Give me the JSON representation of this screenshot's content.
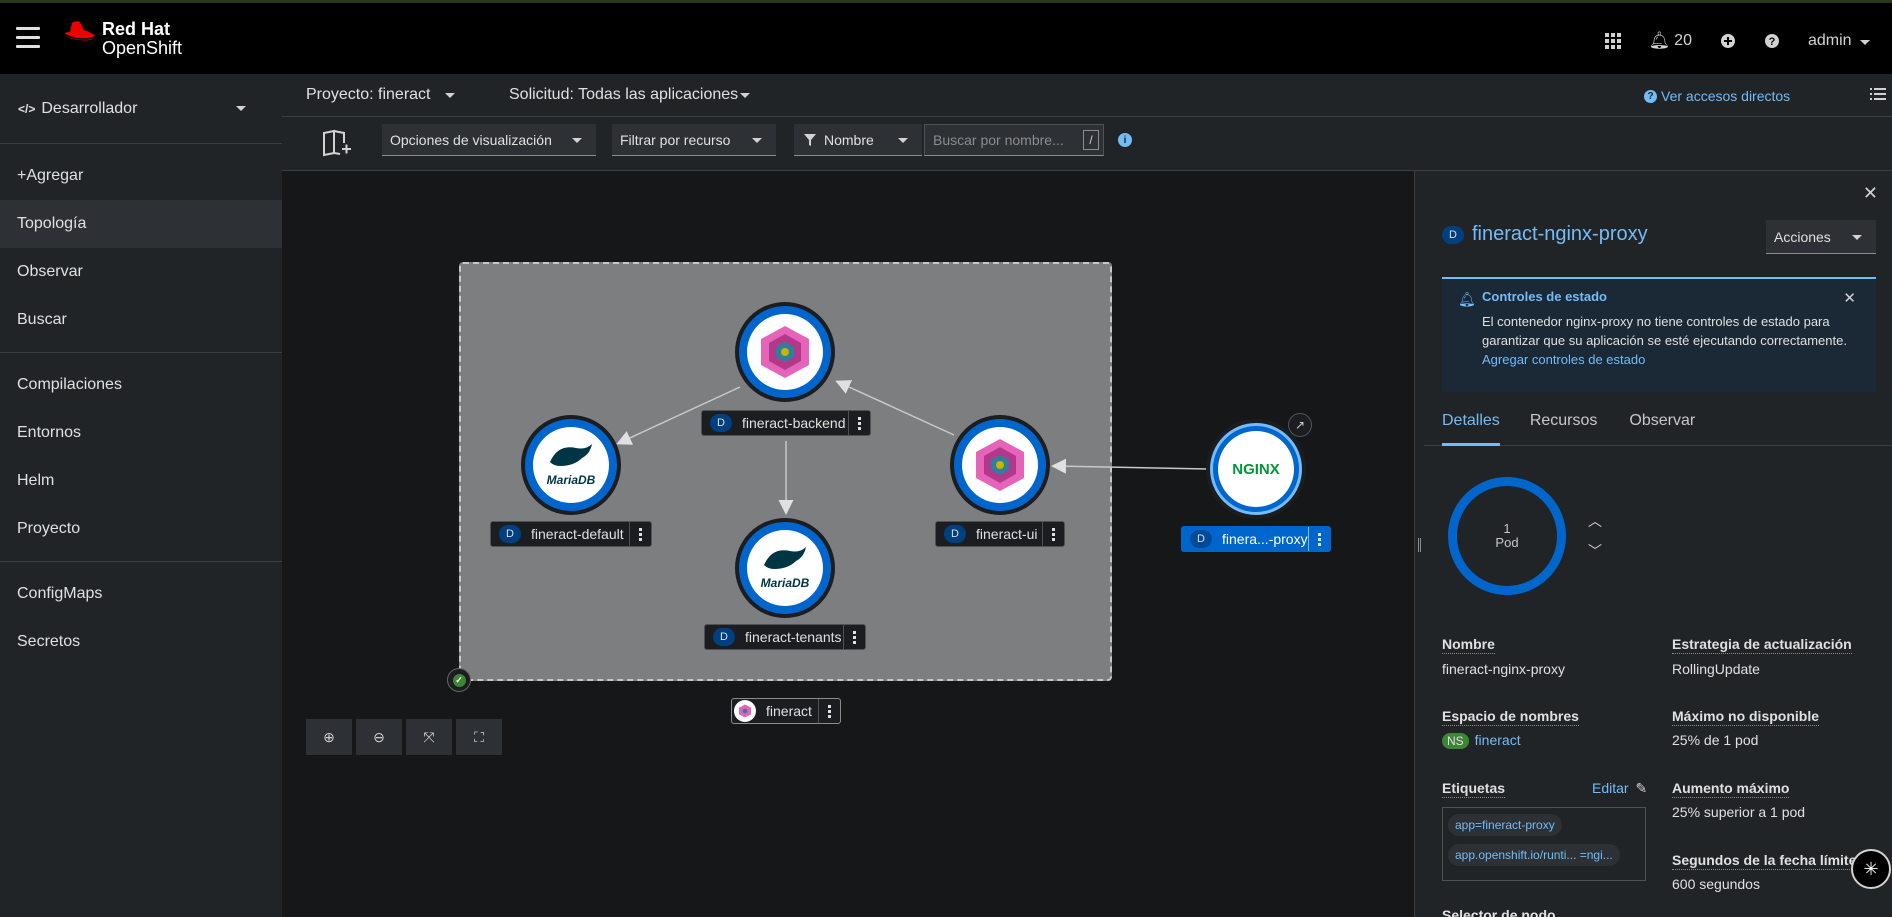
{
  "masthead": {
    "brand_line1": "Red Hat",
    "brand_line2": "OpenShift",
    "notifications_count": "20",
    "user": "admin"
  },
  "sidebar": {
    "perspective": "Desarrollador",
    "groups": [
      [
        "+Agregar",
        "Topología",
        "Observar",
        "Buscar"
      ],
      [
        "Compilaciones",
        "Entornos",
        "Helm",
        "Proyecto"
      ],
      [
        "ConfigMaps",
        "Secretos"
      ]
    ],
    "items": {
      "agregar": "+Agregar",
      "topologia": "Topología",
      "observar": "Observar",
      "buscar": "Buscar",
      "compilaciones": "Compilaciones",
      "entornos": "Entornos",
      "helm": "Helm",
      "proyecto": "Proyecto",
      "configmaps": "ConfigMaps",
      "secretos": "Secretos"
    }
  },
  "projectbar": {
    "project": "Proyecto: fineract",
    "application": "Solicitud: Todas las aplicaciones",
    "shortcuts": "Ver accesos directos"
  },
  "toolbar": {
    "display_options": "Opciones de visualización",
    "filter_resource": "Filtrar por recurso",
    "filter_type": "Nombre",
    "search_placeholder": "Buscar por nombre...",
    "search_shortcut": "/"
  },
  "topology": {
    "application_group": "fineract",
    "nodes": {
      "backend": {
        "badge": "D",
        "name": "fineract-backend"
      },
      "default": {
        "badge": "D",
        "name": "fineract-default"
      },
      "ui": {
        "badge": "D",
        "name": "fineract-ui"
      },
      "tenants": {
        "badge": "D",
        "name": "fineract-tenants"
      },
      "proxy": {
        "badge": "D",
        "name": "finera...-proxy"
      }
    },
    "logos": {
      "mariadb": "MariaDB",
      "nginx": "NGINX"
    }
  },
  "panel": {
    "badge": "D",
    "title": "fineract-nginx-proxy",
    "actions": "Acciones",
    "alert": {
      "title": "Controles de estado",
      "body": "El contenedor nginx-proxy no tiene controles de estado para garantizar que su aplicación se esté ejecutando correctamente.",
      "link": "Agregar controles de estado"
    },
    "tabs": {
      "details": "Detalles",
      "resources": "Recursos",
      "observe": "Observar"
    },
    "pods": {
      "count": "1",
      "unit": "Pod"
    },
    "fields": {
      "name_label": "Nombre",
      "name_value": "fineract-nginx-proxy",
      "strategy_label": "Estrategia de actualización",
      "strategy_value": "RollingUpdate",
      "namespace_label": "Espacio de nombres",
      "namespace_badge": "NS",
      "namespace_value": "fineract",
      "max_unavailable_label": "Máximo no disponible",
      "max_unavailable_value": "25% de 1 pod",
      "labels_label": "Etiquetas",
      "labels_edit": "Editar",
      "max_surge_label": "Aumento máximo",
      "max_surge_value": "25% superior a 1 pod",
      "deadline_label": "Segundos de la fecha límite",
      "deadline_value": "600 segundos",
      "node_selector_label": "Selector de nodo"
    },
    "labels": [
      "app=fineract-proxy",
      "app.openshift.io/runti... =ngi..."
    ]
  }
}
